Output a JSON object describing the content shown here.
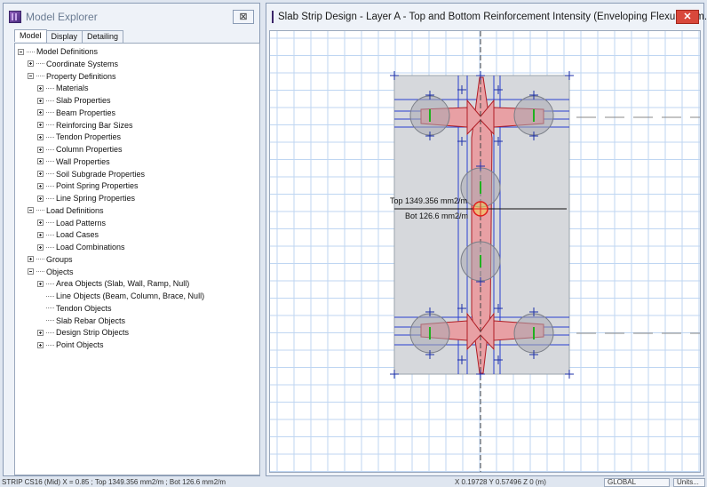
{
  "explorer": {
    "title": "Model Explorer",
    "close_label": "⊠",
    "tabs": [
      "Model",
      "Display",
      "Detailing"
    ],
    "tree": [
      {
        "label": "Model Definitions",
        "toggle": "minus"
      },
      {
        "label": "Coordinate Systems",
        "toggle": "plus"
      },
      {
        "label": "Property Definitions",
        "toggle": "minus"
      },
      {
        "label": "Materials",
        "toggle": "plus"
      },
      {
        "label": "Slab Properties",
        "toggle": "plus"
      },
      {
        "label": "Beam Properties",
        "toggle": "plus"
      },
      {
        "label": "Reinforcing Bar Sizes",
        "toggle": "plus"
      },
      {
        "label": "Tendon Properties",
        "toggle": "plus"
      },
      {
        "label": "Column Properties",
        "toggle": "plus"
      },
      {
        "label": "Wall Properties",
        "toggle": "plus"
      },
      {
        "label": "Soil Subgrade Properties",
        "toggle": "plus"
      },
      {
        "label": "Point Spring Properties",
        "toggle": "plus"
      },
      {
        "label": "Line Spring Properties",
        "toggle": "plus"
      },
      {
        "label": "Load Definitions",
        "toggle": "minus"
      },
      {
        "label": "Load Patterns",
        "toggle": "plus"
      },
      {
        "label": "Load Cases",
        "toggle": "plus"
      },
      {
        "label": "Load Combinations",
        "toggle": "plus"
      },
      {
        "label": "Groups",
        "toggle": "plus"
      },
      {
        "label": "Objects",
        "toggle": "minus"
      },
      {
        "label": "Area Objects (Slab, Wall, Ramp, Null)",
        "toggle": "plus"
      },
      {
        "label": "Line Objects (Beam, Column, Brace, Null)",
        "toggle": "none"
      },
      {
        "label": "Tendon Objects",
        "toggle": "none"
      },
      {
        "label": "Slab Rebar Objects",
        "toggle": "none"
      },
      {
        "label": "Design Strip Objects",
        "toggle": "plus"
      },
      {
        "label": "Point Objects",
        "toggle": "plus"
      }
    ]
  },
  "drawing": {
    "title": "Slab Strip Design - Layer A - Top and Bottom Reinforcement Intensity (Enveloping Flexural)  [m...",
    "close_label": "✕",
    "tooltip_top": "Top 1349.356 mm2/m",
    "tooltip_bot": "Bot 126.6 mm2/m",
    "colors": {
      "strip_fill": "#e8a0a4",
      "strip_edge": "#b01c24",
      "slab": "#d6d8dc",
      "grid": "#bfd6f2",
      "strip_line": "#2b3fd0"
    }
  },
  "status": {
    "left": "STRIP CS16  (Mid)  X = 0.85  ;  Top 1349.356 mm2/m ;  Bot 126.6 mm2/m",
    "coords": "X 0.19728   Y 0.57496   Z 0 (m)",
    "view": "GLOBAL",
    "units": "Units..."
  }
}
